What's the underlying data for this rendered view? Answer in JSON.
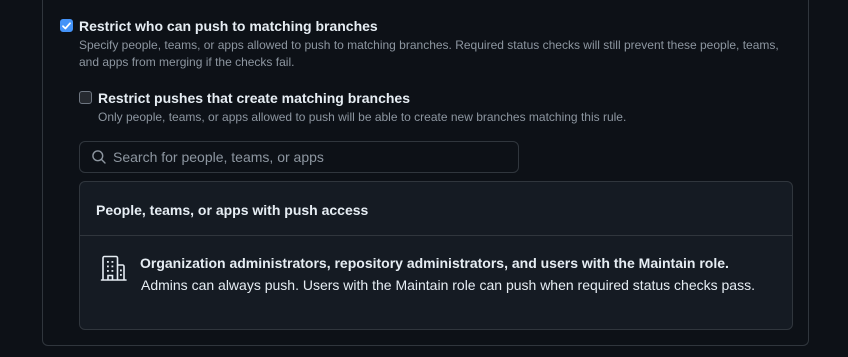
{
  "restrict_push": {
    "checked": true,
    "title": "Restrict who can push to matching branches",
    "description": "Specify people, teams, or apps allowed to push to matching branches. Required status checks will still prevent these people, teams, and apps from merging if the checks fail."
  },
  "restrict_create": {
    "checked": false,
    "title": "Restrict pushes that create matching branches",
    "description": "Only people, teams, or apps allowed to push will be able to create new branches matching this rule."
  },
  "search": {
    "icon": "search-icon",
    "placeholder": "Search for people, teams, or apps",
    "value": ""
  },
  "push_access": {
    "header": "People, teams, or apps with push access",
    "items": [
      {
        "icon": "organization-icon",
        "title": "Organization administrators, repository administrators, and users with the Maintain role.",
        "description": "Admins can always push. Users with the Maintain role can push when required status checks pass."
      }
    ]
  },
  "colors": {
    "background": "#0d1117",
    "accent": "#4493f8",
    "border": "#30363d",
    "muted_text": "#8d96a0"
  }
}
